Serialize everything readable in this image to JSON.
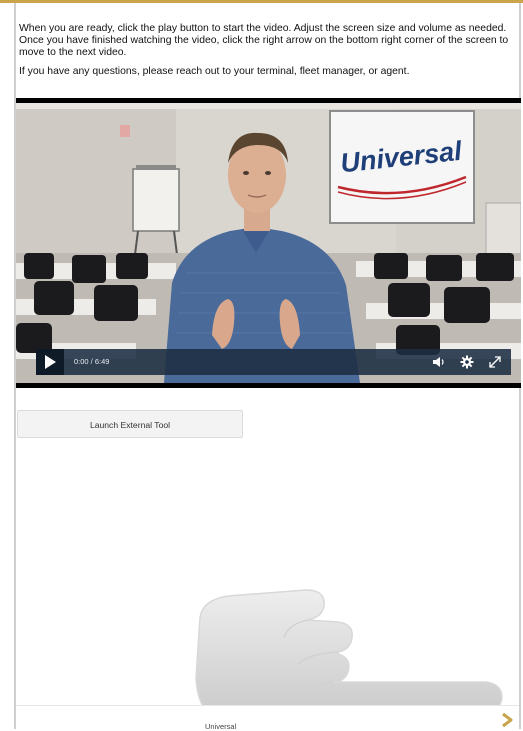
{
  "instructions": {
    "paragraph1": "When you are ready, click the play button to start the video.  Adjust the screen size and volume as needed.  Once you have finished watching the video, click the right arrow on the bottom right corner of the screen to move to the next video.",
    "paragraph2": "If you have any questions, please reach out to your terminal, fleet manager, or agent."
  },
  "video": {
    "screen_logo": "Universal",
    "time_display": "0:00 / 6:49",
    "controls": [
      "play-icon",
      "volume-icon",
      "settings-gear-icon",
      "fullscreen-icon"
    ],
    "control_bar_color": "#1c2e42"
  },
  "launch_button_label": "Launch External Tool",
  "footer": {
    "label": "Universal",
    "next_icon": "chevron-right-icon",
    "next_color": "#c9a44a"
  },
  "colors": {
    "accent": "#c9a44a",
    "brand_red": "#c0272d"
  }
}
